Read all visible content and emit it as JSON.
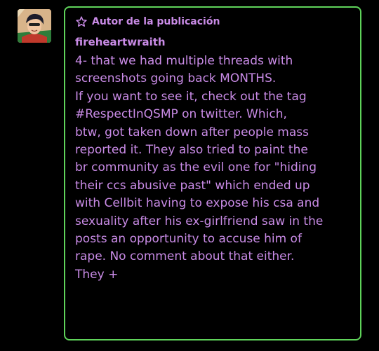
{
  "post": {
    "avatar_icon": "user-avatar",
    "badge": {
      "icon": "star-outline-icon",
      "label": "Autor de la publicación"
    },
    "username": "fireheartwraith",
    "lines": [
      "4- that we had multiple threads with",
      "screenshots going back MONTHS.",
      "If you want to see it, check out the tag",
      "#RespectInQSMP on twitter. Which,",
      "btw, got taken down after people mass",
      "reported it. They also tried to paint the",
      "br community as the evil one for \"hiding",
      "their ccs abusive past\" which ended up",
      "with Cellbit having to expose his csa and",
      "sexuality after his ex-girlfriend saw in the",
      "posts an opportunity to accuse him of",
      "rape. No comment about that either.",
      "They +"
    ]
  },
  "colors": {
    "text": "#c98be6",
    "border": "#5fd35a",
    "background": "#000000"
  }
}
